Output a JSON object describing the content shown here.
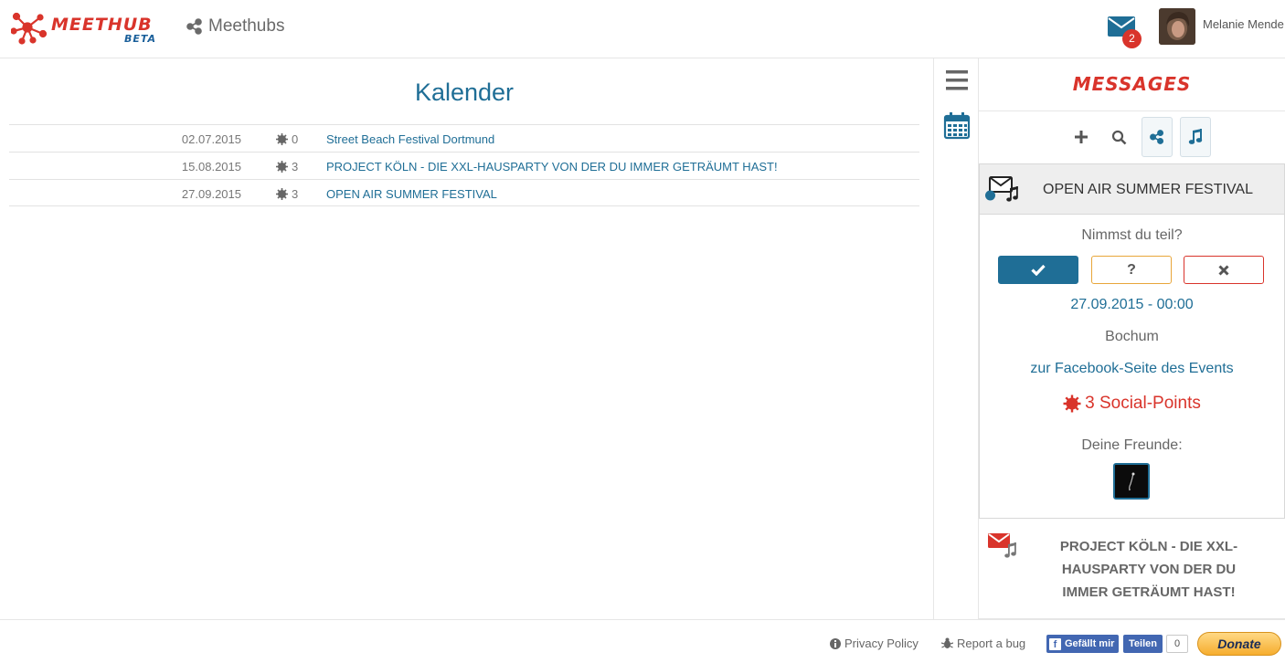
{
  "header": {
    "logo_text": "MEETHUB",
    "logo_badge": "BETA",
    "nav_meethubs": "Meethubs",
    "mail_badge_count": "2",
    "username": "Melanie Mende"
  },
  "calendar": {
    "title": "Kalender",
    "rows": [
      {
        "date": "02.07.2015",
        "points": "0",
        "title": "Street Beach Festival Dortmund"
      },
      {
        "date": "15.08.2015",
        "points": "3",
        "title": "PROJECT KÖLN - DIE XXL-HAUSPARTY VON DER DU IMMER GETRÄUMT HAST!"
      },
      {
        "date": "27.09.2015",
        "points": "3",
        "title": "OPEN AIR SUMMER FESTIVAL"
      }
    ]
  },
  "toolbar": {
    "icons": [
      "menu-icon",
      "calendar-icon"
    ]
  },
  "messages": {
    "title": "MESSAGES",
    "tools": [
      "plus-icon",
      "search-icon",
      "share-icon",
      "music-note-icon"
    ],
    "active": {
      "title": "OPEN AIR SUMMER FESTIVAL",
      "question": "Nimmst du teil?",
      "rsvp_maybe": "?",
      "datetime": "27.09.2015 - 00:00",
      "location": "Bochum",
      "facebook_link": "zur Facebook-Seite des Events",
      "social_points": "3 Social-Points",
      "friends_label": "Deine Freunde:"
    },
    "second": {
      "title": "PROJECT KÖLN - DIE XXL-HAUSPARTY VON DER DU IMMER GETRÄUMT HAST!"
    }
  },
  "footer": {
    "privacy": "Privacy Policy",
    "report_bug": "Report a bug",
    "fb_like": "Gefällt mir",
    "fb_share": "Teilen",
    "fb_count": "0",
    "donate": "Donate"
  },
  "colors": {
    "brand_red": "#d9342b",
    "brand_blue": "#1f6e96",
    "maybe_orange": "#e8a63a"
  }
}
